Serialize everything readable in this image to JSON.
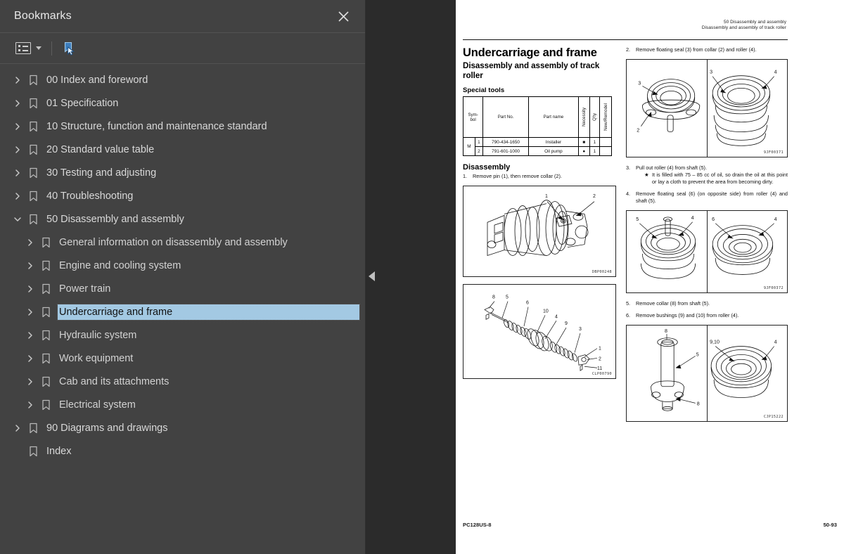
{
  "panel": {
    "title": "Bookmarks",
    "close_label": "Close",
    "toolbar": {
      "list_options_label": "List options",
      "bookmark_tool_label": "Bookmark selection"
    },
    "items": [
      {
        "label": "00 Index and foreword",
        "depth": 0,
        "expanded": false,
        "has_children": true,
        "selected": false
      },
      {
        "label": "01 Specification",
        "depth": 0,
        "expanded": false,
        "has_children": true,
        "selected": false
      },
      {
        "label": "10 Structure, function and maintenance standard",
        "depth": 0,
        "expanded": false,
        "has_children": true,
        "selected": false
      },
      {
        "label": "20 Standard value table",
        "depth": 0,
        "expanded": false,
        "has_children": true,
        "selected": false
      },
      {
        "label": "30 Testing and adjusting",
        "depth": 0,
        "expanded": false,
        "has_children": true,
        "selected": false
      },
      {
        "label": "40 Troubleshooting",
        "depth": 0,
        "expanded": false,
        "has_children": true,
        "selected": false
      },
      {
        "label": "50 Disassembly and assembly",
        "depth": 0,
        "expanded": true,
        "has_children": true,
        "selected": false
      },
      {
        "label": "General information on disassembly and assembly",
        "depth": 1,
        "expanded": false,
        "has_children": true,
        "selected": false
      },
      {
        "label": "Engine and cooling system",
        "depth": 1,
        "expanded": false,
        "has_children": true,
        "selected": false
      },
      {
        "label": "Power train",
        "depth": 1,
        "expanded": false,
        "has_children": true,
        "selected": false
      },
      {
        "label": "Undercarriage and frame",
        "depth": 1,
        "expanded": false,
        "has_children": true,
        "selected": true
      },
      {
        "label": "Hydraulic system",
        "depth": 1,
        "expanded": false,
        "has_children": true,
        "selected": false
      },
      {
        "label": "Work equipment",
        "depth": 1,
        "expanded": false,
        "has_children": true,
        "selected": false
      },
      {
        "label": "Cab and its attachments",
        "depth": 1,
        "expanded": false,
        "has_children": true,
        "selected": false
      },
      {
        "label": "Electrical system",
        "depth": 1,
        "expanded": false,
        "has_children": true,
        "selected": false
      },
      {
        "label": "90 Diagrams and drawings",
        "depth": 0,
        "expanded": false,
        "has_children": true,
        "selected": false
      },
      {
        "label": "Index",
        "depth": 0,
        "expanded": false,
        "has_children": false,
        "selected": false
      }
    ]
  },
  "colors": {
    "panel_bg": "#424242",
    "viewer_bg": "#2b2b2b",
    "selection": "#a3c9e3",
    "text": "#d8d8d8"
  },
  "page": {
    "header_line1": "50 Disassembly and assembly",
    "header_line2": "Disassembly and assembly of track roller",
    "title": "Undercarriage and frame",
    "subtitle": "Disassembly and assembly of track roller",
    "special_tools_heading": "Special tools",
    "tools_table": {
      "headers": [
        "Sym-\nbol",
        "",
        "Part No.",
        "Part name",
        "Necessity",
        "Q'ty",
        "New/Remodel"
      ],
      "header_symbol": "Sym-",
      "header_symbol2": "bol",
      "header_partno": "Part No.",
      "header_partname": "Part name",
      "header_necessity": "Necessity",
      "header_qty": "Q'ty",
      "header_newremodel": "New/Remodel",
      "symbol_group": "M",
      "rows": [
        {
          "num": "1",
          "part_no": "790-434-1650",
          "part_name": "Installer",
          "necessity": "■",
          "qty": "1",
          "new_remodel": ""
        },
        {
          "num": "2",
          "part_no": "791-601-1000",
          "part_name": "Oil pump",
          "necessity": "●",
          "qty": "1",
          "new_remodel": ""
        }
      ]
    },
    "disassembly_heading": "Disassembly",
    "steps": [
      {
        "n": "1.",
        "text": "Remove pin (1), then remove collar (2)."
      },
      {
        "n": "2.",
        "text": "Remove floating seal (3) from collar (2) and roller (4)."
      },
      {
        "n": "3.",
        "text": "Pull out roller (4) from shaft (5).",
        "sub": "It is filled with 75 – 85 cc of oil, so drain the oil at this point or lay a cloth to prevent the area from becoming dirty.",
        "sub_marker": "★"
      },
      {
        "n": "4.",
        "text": "Remove floating seal (6) (on opposite side) from roller (4) and shaft (5)."
      },
      {
        "n": "5.",
        "text": "Remove collar (8) from shaft (5)."
      },
      {
        "n": "6.",
        "text": "Remove bushings (9) and (10) from roller (4)."
      }
    ],
    "figures": [
      {
        "id": "fig-track-roller-assembly",
        "caption": "DBP00248",
        "callouts": [
          "1",
          "2"
        ]
      },
      {
        "id": "fig-exploded-view",
        "caption": "CLP00790",
        "callouts": [
          "8",
          "5",
          "6",
          "10",
          "4",
          "9",
          "3",
          "1",
          "2",
          "11"
        ]
      },
      {
        "id": "fig-floating-seal-collar",
        "caption": "9JF00371",
        "callouts": [
          "3",
          "2",
          "3",
          "4"
        ]
      },
      {
        "id": "fig-floating-seal-roller",
        "caption": "9JF00372",
        "callouts": [
          "5",
          "4",
          "6",
          "4"
        ]
      },
      {
        "id": "fig-bushings-removal",
        "caption": "CJP15222",
        "callouts": [
          "8",
          "5",
          "9,10",
          "4",
          "8"
        ]
      }
    ],
    "footer_left": "PC128US-8",
    "footer_right": "50-93"
  }
}
